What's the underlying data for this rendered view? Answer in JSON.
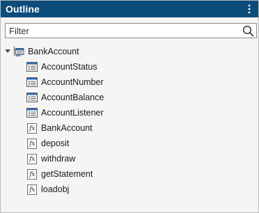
{
  "panel": {
    "title": "Outline",
    "menu_icon": "vertical-ellipsis-icon"
  },
  "filter": {
    "placeholder": "Filter",
    "value": "",
    "icon": "search-icon"
  },
  "tree": {
    "root": {
      "label": "BankAccount",
      "expanded": true,
      "icon": "class-icon"
    },
    "properties": [
      {
        "label": "AccountStatus",
        "icon": "property-icon"
      },
      {
        "label": "AccountNumber",
        "icon": "property-icon"
      },
      {
        "label": "AccountBalance",
        "icon": "property-icon"
      },
      {
        "label": "AccountListener",
        "icon": "property-icon"
      }
    ],
    "methods": [
      {
        "label": "BankAccount",
        "icon": "function-icon"
      },
      {
        "label": "deposit",
        "icon": "function-icon"
      },
      {
        "label": "withdraw",
        "icon": "function-icon"
      },
      {
        "label": "getStatement",
        "icon": "function-icon"
      },
      {
        "label": "loadobj",
        "icon": "function-icon"
      }
    ],
    "function_glyph": "fx"
  },
  "colors": {
    "titlebar": "#0b4c7a",
    "property_header": "#2a6fc0"
  }
}
